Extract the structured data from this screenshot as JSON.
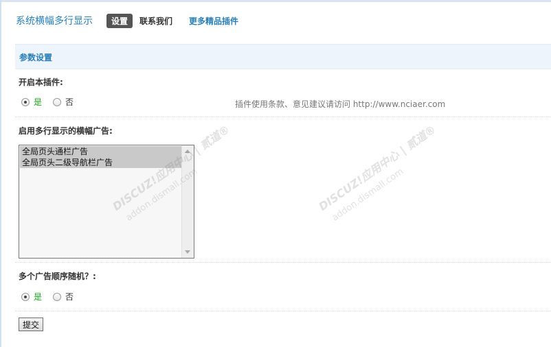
{
  "header": {
    "plugin_title": "系统横幅多行显示",
    "tabs": [
      {
        "label": "设置",
        "active": true
      },
      {
        "label": "联系我们",
        "active": false
      },
      {
        "label": "更多精品插件",
        "active": false
      }
    ]
  },
  "section": {
    "title": "参数设置"
  },
  "settings": {
    "enable_plugin": {
      "label": "开启本插件:",
      "options": [
        "是",
        "否"
      ],
      "selected": "是"
    },
    "hint": "插件使用条款、意见建议请访问 http://www.nciaer.com",
    "banner_ads": {
      "label": "启用多行显示的横幅广告:",
      "items": [
        "全局页头通栏广告",
        "全局页头二级导航栏广告"
      ]
    },
    "random_order": {
      "label": "多个广告顺序随机？:",
      "options": [
        "是",
        "否"
      ],
      "selected": "是"
    },
    "submit_label": "提交"
  },
  "watermark": {
    "line1": "DISCUZ!应用中心 | 贰道®",
    "line2": "addon.dismall.com"
  },
  "colors": {
    "accent": "#2a7fb8",
    "section_bg": "#eef4fb",
    "yes_green": "#19a319"
  }
}
